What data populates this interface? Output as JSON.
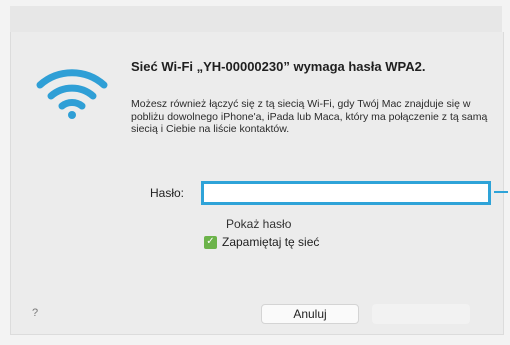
{
  "dialog": {
    "heading": "Sieć Wi-Fi „YH-00000230” wymaga hasła WPA2.",
    "description": "Możesz również łączyć się z tą siecią Wi-Fi, gdy Twój Mac znajduje się w pobliżu dowolnego iPhone'a, iPada lub Maca, który ma połączenie z tą samą siecią i Ciebie na liście kontaktów.",
    "icon": "wifi-icon"
  },
  "form": {
    "password_label": "Hasło:",
    "password_value": "",
    "show_password_label": "Pokaż hasło",
    "remember_label": "Zapamiętaj tę sieć",
    "remember_checked": true
  },
  "footer": {
    "help_label": "?",
    "cancel_label": "Anuluj"
  },
  "colors": {
    "accent": "#2ea3d8",
    "checkbox": "#6cb34a",
    "wifi_icon": "#2f9fd6"
  }
}
